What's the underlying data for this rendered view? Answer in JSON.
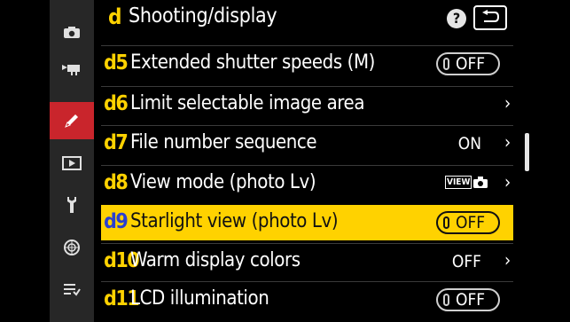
{
  "header": {
    "menu_letter": "d",
    "title": "Shooting/display",
    "help_label": "?",
    "back_icon": "return-arrow-icon",
    "accent_color": "#ffd200"
  },
  "sidebar": {
    "items": [
      {
        "name": "camera-icon",
        "active": false
      },
      {
        "name": "movie-camera-icon",
        "active": false
      },
      {
        "name": "pencil-icon",
        "active": true
      },
      {
        "name": "playback-icon",
        "active": false
      },
      {
        "name": "wrench-icon",
        "active": false
      },
      {
        "name": "network-icon",
        "active": false
      },
      {
        "name": "my-menu-icon",
        "active": false
      }
    ],
    "active_color": "#c9252c"
  },
  "rows": [
    {
      "code": "d5",
      "label": "Extended shutter speeds (M)",
      "value": "OFF",
      "control": "toggle"
    },
    {
      "code": "d6",
      "label": "Limit selectable image area",
      "value": "",
      "control": "chevron"
    },
    {
      "code": "d7",
      "label": "File number sequence",
      "value": "ON",
      "control": "chevron"
    },
    {
      "code": "d8",
      "label": "View mode (photo Lv)",
      "value": "VIEW",
      "control": "viewmode"
    },
    {
      "code": "d9",
      "label": "Starlight view (photo Lv)",
      "value": "OFF",
      "control": "toggle",
      "highlighted": true
    },
    {
      "code": "d10",
      "label": "Warm display colors",
      "value": "OFF",
      "control": "chevron"
    },
    {
      "code": "d11",
      "label": "LCD illumination",
      "value": "OFF",
      "control": "toggle"
    }
  ],
  "highlight_color": "#ffd200"
}
